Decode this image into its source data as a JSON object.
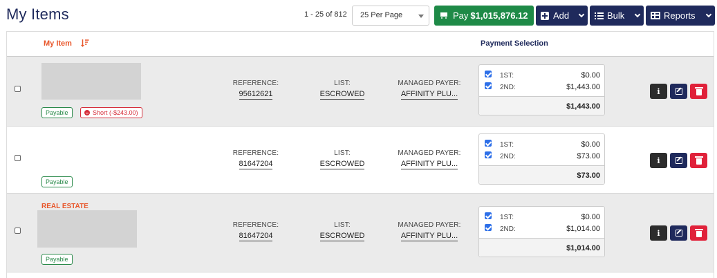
{
  "header": {
    "title": "My Items",
    "range": "1 - 25 of 812",
    "per_page": "25 Per Page",
    "pay_label": "Pay",
    "pay_amount": "$1,015,876.12",
    "add_label": "Add",
    "bulk_label": "Bulk",
    "reports_label": "Reports"
  },
  "columns": {
    "my_item": "My Item",
    "payment_selection": "Payment Selection"
  },
  "rows": [
    {
      "category": "",
      "badges": [
        "Payable",
        "Short (-$243.00)"
      ],
      "reference_label": "REFERENCE:",
      "reference": "95612621",
      "list_label": "LIST:",
      "list": "ESCROWED",
      "payer_label": "MANAGED PAYER:",
      "payer": "AFFINITY PLU...",
      "payments": [
        {
          "name": "1ST:",
          "amount": "$0.00"
        },
        {
          "name": "2ND:",
          "amount": "$1,443.00"
        }
      ],
      "total": "$1,443.00"
    },
    {
      "category": "",
      "badges": [
        "Payable"
      ],
      "reference_label": "REFERENCE:",
      "reference": "81647204",
      "list_label": "LIST:",
      "list": "ESCROWED",
      "payer_label": "MANAGED PAYER:",
      "payer": "AFFINITY PLU...",
      "payments": [
        {
          "name": "1ST:",
          "amount": "$0.00"
        },
        {
          "name": "2ND:",
          "amount": "$73.00"
        }
      ],
      "total": "$73.00"
    },
    {
      "category": "REAL ESTATE",
      "badges": [
        "Payable"
      ],
      "reference_label": "REFERENCE:",
      "reference": "81647204",
      "list_label": "LIST:",
      "list": "ESCROWED",
      "payer_label": "MANAGED PAYER:",
      "payer": "AFFINITY PLU...",
      "payments": [
        {
          "name": "1ST:",
          "amount": "$0.00"
        },
        {
          "name": "2ND:",
          "amount": "$1,014.00"
        }
      ],
      "total": "$1,014.00"
    }
  ],
  "actions": {
    "info_glyph": "i"
  },
  "colors": {
    "brand_navy": "#1f2a5c",
    "pay_green": "#1e8a47",
    "accent_orange": "#e8562a",
    "danger_red": "#e0213a",
    "checkbox_blue": "#2d6fe8"
  }
}
